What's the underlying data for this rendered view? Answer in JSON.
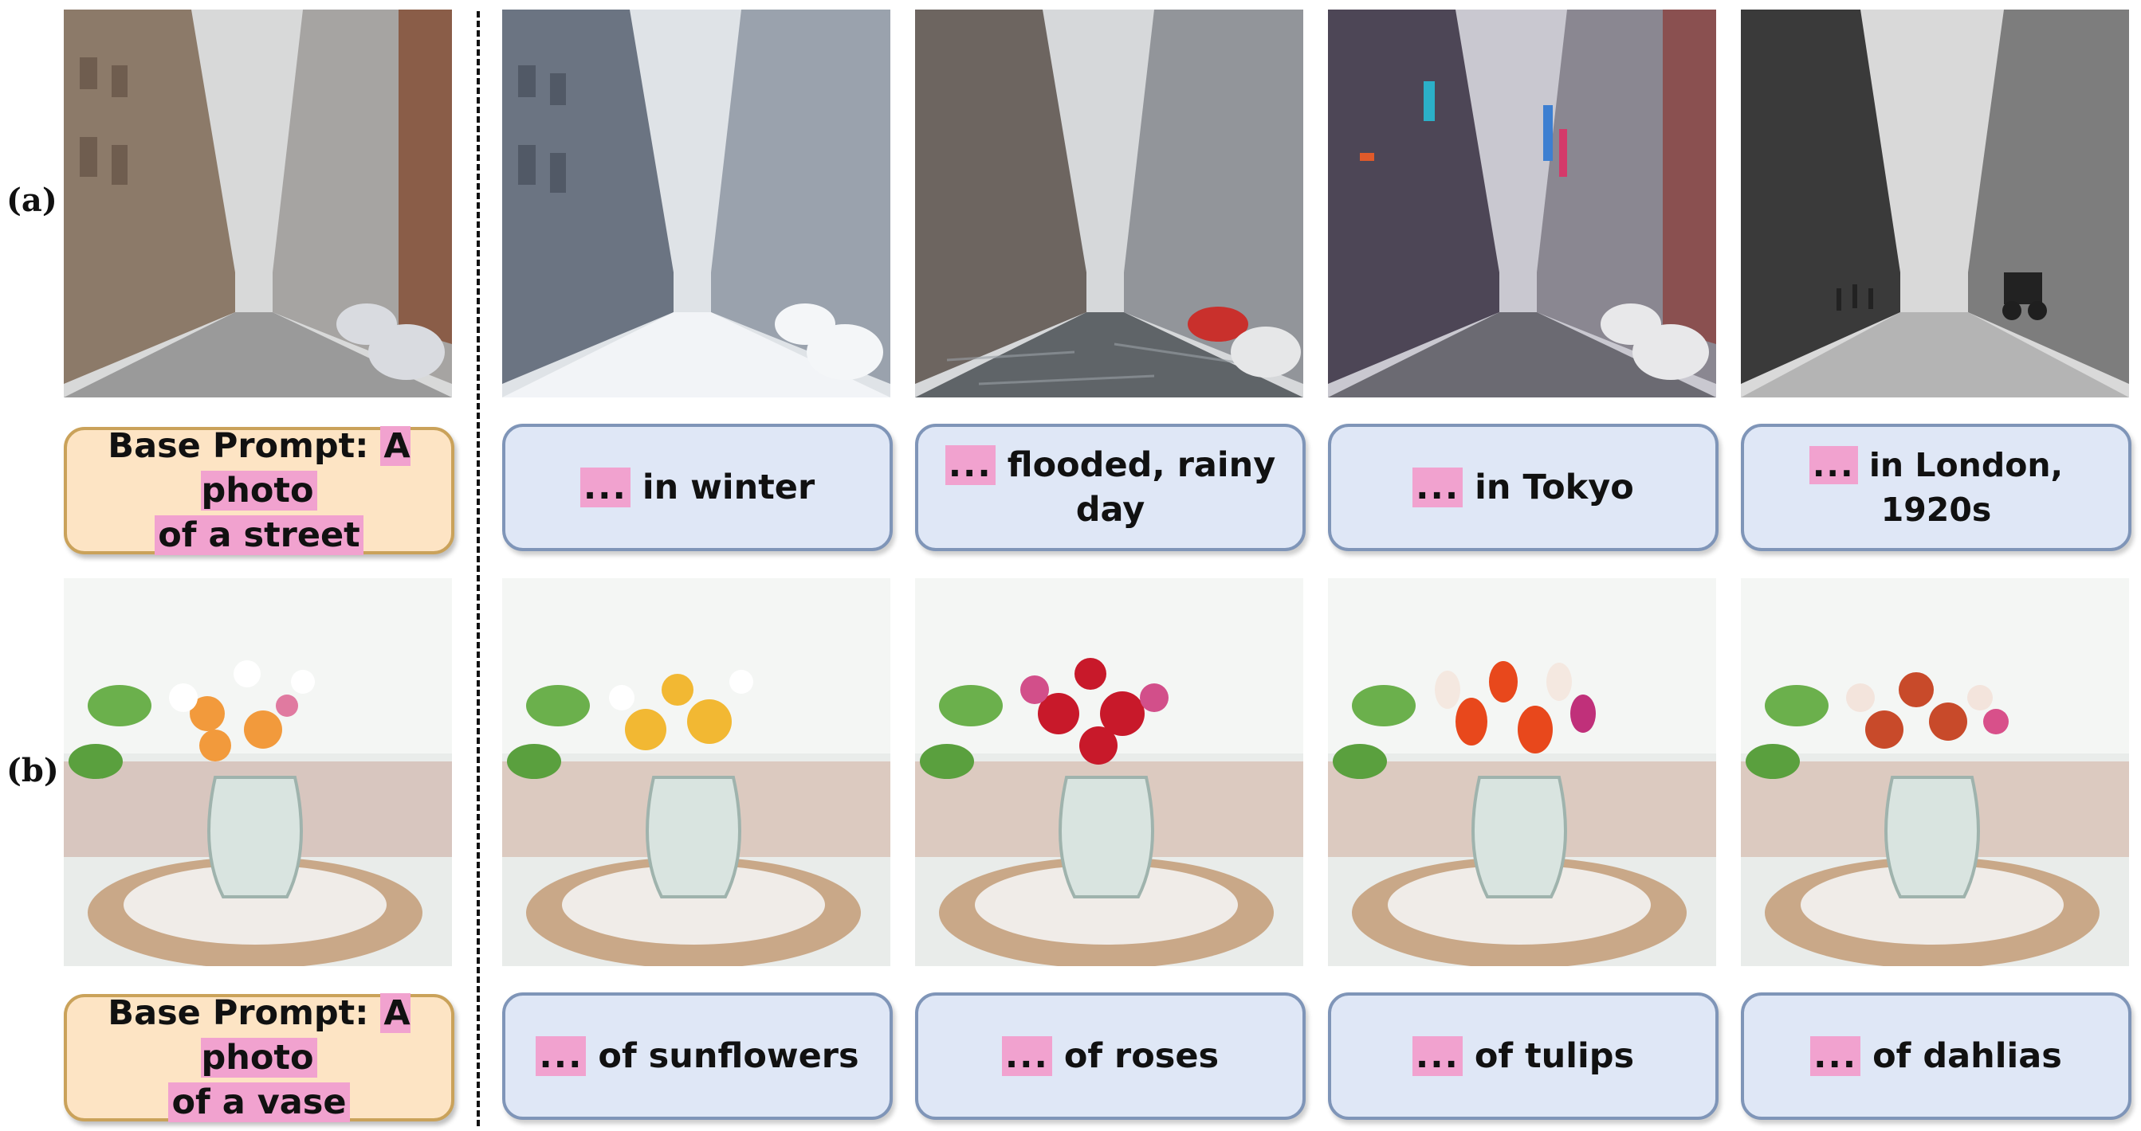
{
  "labels": {
    "a": "(a)",
    "b": "(b)"
  },
  "row_a": {
    "base_prompt": {
      "prefix": "Base Prompt:",
      "highlight_1": "A photo",
      "highlight_2": "of a street"
    },
    "variations": [
      {
        "dots": "...",
        "text": "in winter"
      },
      {
        "dots": "...",
        "text": "flooded, rainy",
        "text_2": "day"
      },
      {
        "dots": "...",
        "text": "in Tokyo"
      },
      {
        "dots": "...",
        "text": "in London, 1920s"
      }
    ]
  },
  "row_b": {
    "base_prompt": {
      "prefix": "Base Prompt:",
      "highlight_1": "A photo",
      "highlight_2": "of a vase"
    },
    "variations": [
      {
        "dots": "...",
        "text": "of sunflowers"
      },
      {
        "dots": "...",
        "text": "of roses"
      },
      {
        "dots": "...",
        "text": "of tulips"
      },
      {
        "dots": "...",
        "text": "of dahlias"
      }
    ]
  },
  "colors": {
    "base_fill": "#fde4c4",
    "base_border": "#caa25a",
    "var_fill": "#dfe7f6",
    "var_border": "#7f95b8",
    "highlight": "#f1a2cf"
  }
}
